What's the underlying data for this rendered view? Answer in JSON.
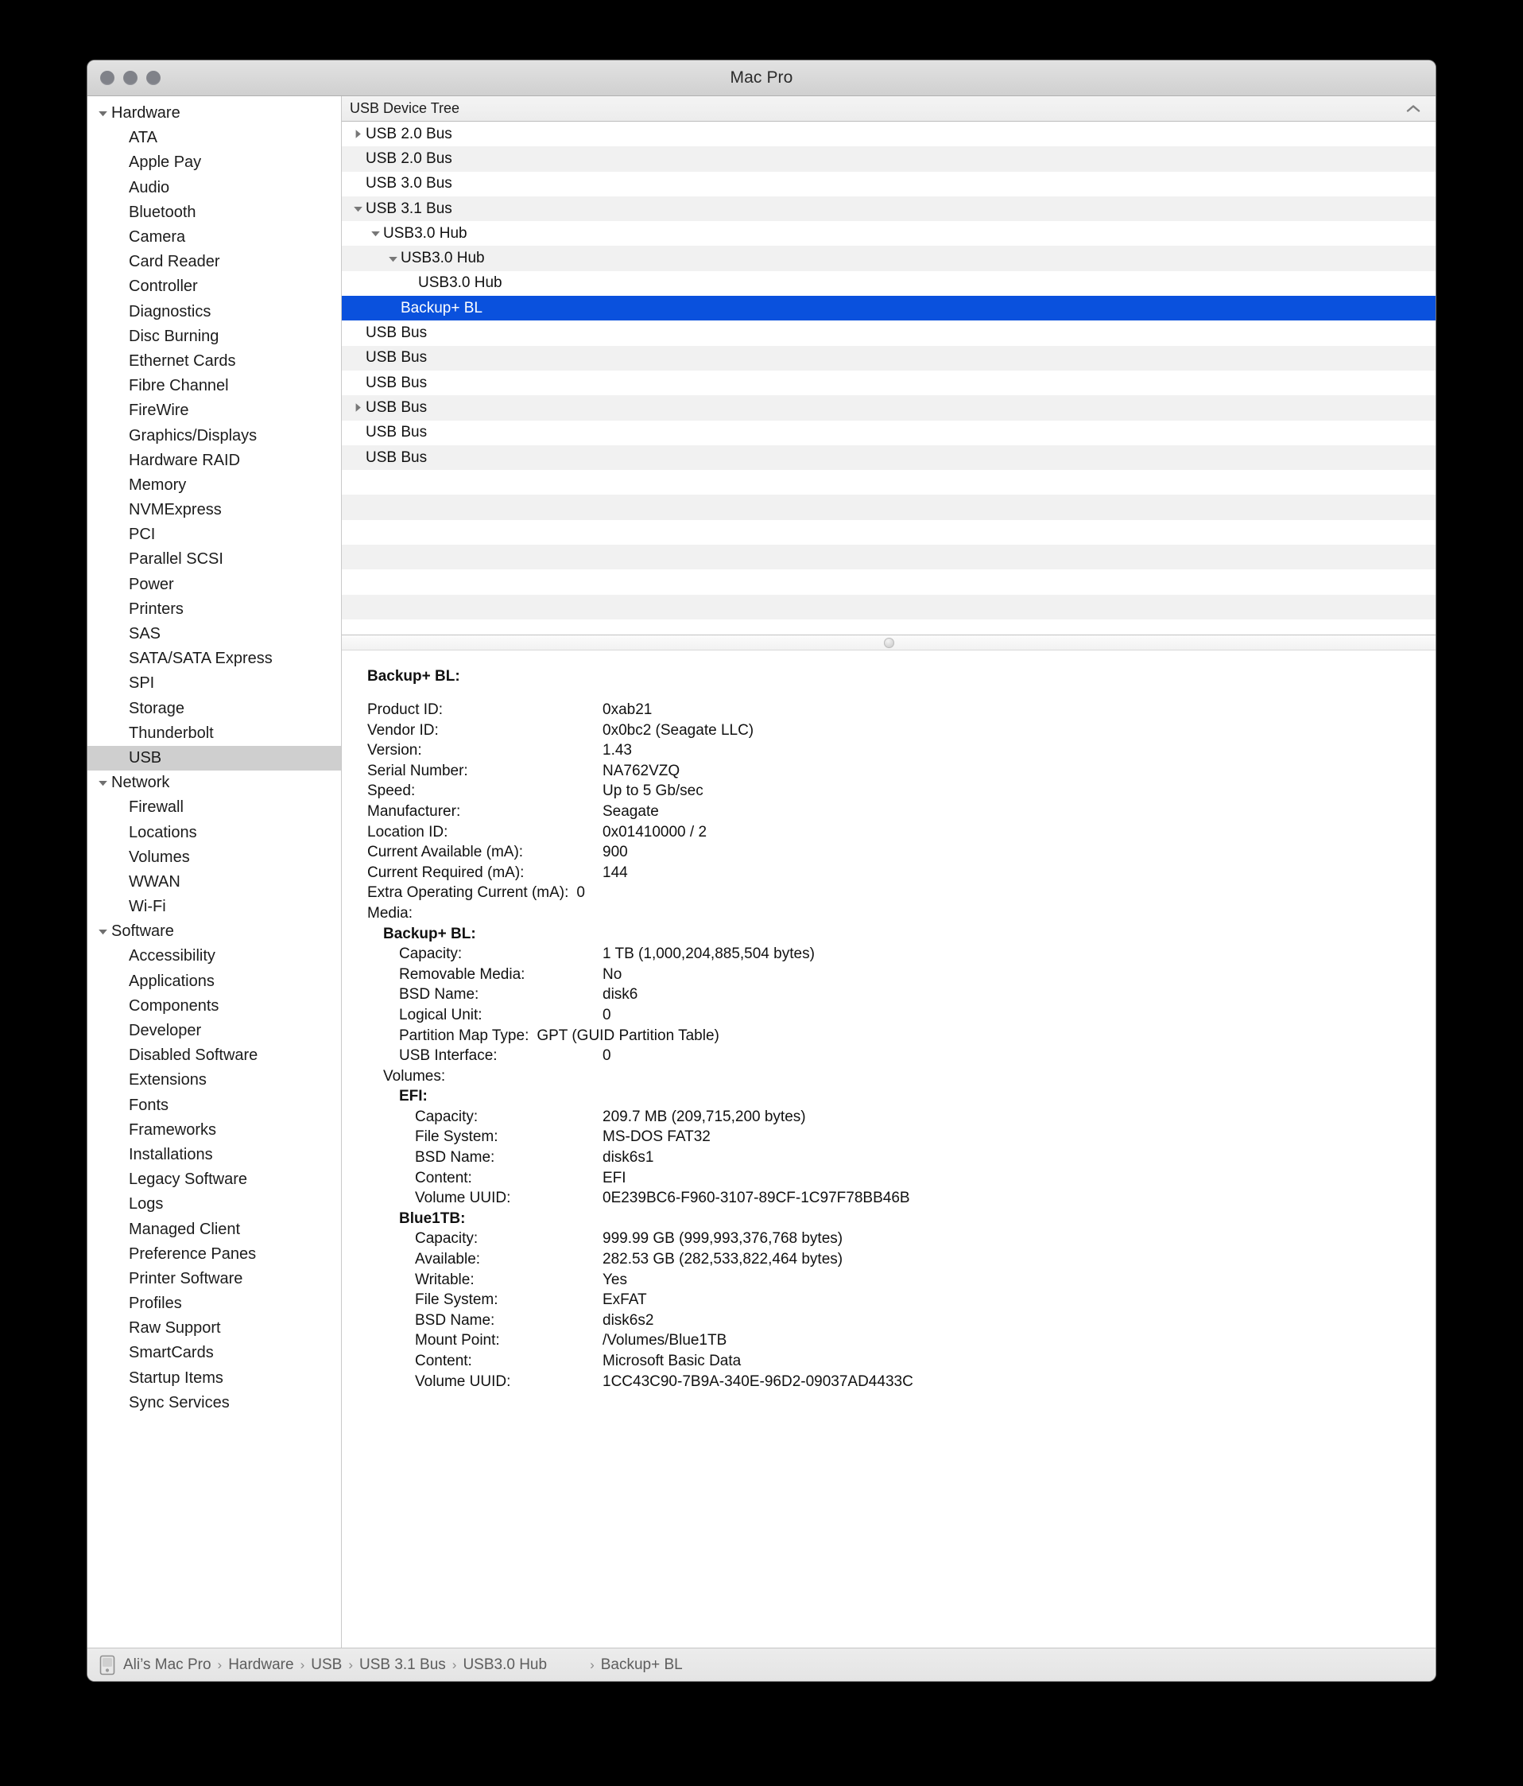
{
  "window": {
    "title": "Mac Pro",
    "traffic_lights": [
      "close",
      "minimize",
      "zoom"
    ]
  },
  "sidebar": {
    "groups": [
      {
        "label": "Hardware",
        "expanded": true,
        "items": [
          "ATA",
          "Apple Pay",
          "Audio",
          "Bluetooth",
          "Camera",
          "Card Reader",
          "Controller",
          "Diagnostics",
          "Disc Burning",
          "Ethernet Cards",
          "Fibre Channel",
          "FireWire",
          "Graphics/Displays",
          "Hardware RAID",
          "Memory",
          "NVMExpress",
          "PCI",
          "Parallel SCSI",
          "Power",
          "Printers",
          "SAS",
          "SATA/SATA Express",
          "SPI",
          "Storage",
          "Thunderbolt",
          "USB"
        ]
      },
      {
        "label": "Network",
        "expanded": true,
        "items": [
          "Firewall",
          "Locations",
          "Volumes",
          "WWAN",
          "Wi-Fi"
        ]
      },
      {
        "label": "Software",
        "expanded": true,
        "items": [
          "Accessibility",
          "Applications",
          "Components",
          "Developer",
          "Disabled Software",
          "Extensions",
          "Fonts",
          "Frameworks",
          "Installations",
          "Legacy Software",
          "Logs",
          "Managed Client",
          "Preference Panes",
          "Printer Software",
          "Profiles",
          "Raw Support",
          "SmartCards",
          "Startup Items",
          "Sync Services"
        ]
      }
    ],
    "selected": "USB"
  },
  "tree": {
    "header": "USB Device Tree",
    "sort_indicator": "chevron-up",
    "rows": [
      {
        "label": "USB 2.0 Bus",
        "depth": 0,
        "disclosure": "collapsed",
        "selected": false
      },
      {
        "label": "USB 2.0 Bus",
        "depth": 0,
        "disclosure": "none",
        "selected": false
      },
      {
        "label": "USB 3.0 Bus",
        "depth": 0,
        "disclosure": "none",
        "selected": false
      },
      {
        "label": "USB 3.1 Bus",
        "depth": 0,
        "disclosure": "expanded",
        "selected": false
      },
      {
        "label": "USB3.0 Hub",
        "depth": 1,
        "disclosure": "expanded",
        "selected": false
      },
      {
        "label": "USB3.0 Hub",
        "depth": 2,
        "disclosure": "expanded",
        "selected": false
      },
      {
        "label": "USB3.0 Hub",
        "depth": 3,
        "disclosure": "none",
        "selected": false
      },
      {
        "label": "Backup+  BL",
        "depth": 2,
        "disclosure": "none",
        "selected": true
      },
      {
        "label": "USB Bus",
        "depth": 0,
        "disclosure": "none",
        "selected": false
      },
      {
        "label": "USB Bus",
        "depth": 0,
        "disclosure": "none",
        "selected": false
      },
      {
        "label": "USB Bus",
        "depth": 0,
        "disclosure": "none",
        "selected": false
      },
      {
        "label": "USB Bus",
        "depth": 0,
        "disclosure": "collapsed",
        "selected": false
      },
      {
        "label": "USB Bus",
        "depth": 0,
        "disclosure": "none",
        "selected": false
      },
      {
        "label": "USB Bus",
        "depth": 0,
        "disclosure": "none",
        "selected": false
      }
    ]
  },
  "detail": {
    "title": "Backup+  BL:",
    "device_properties": [
      {
        "key": "Product ID:",
        "value": "0xab21"
      },
      {
        "key": "Vendor ID:",
        "value": "0x0bc2  (Seagate LLC)"
      },
      {
        "key": "Version:",
        "value": "1.43"
      },
      {
        "key": "Serial Number:",
        "value": "NA762VZQ"
      },
      {
        "key": "Speed:",
        "value": "Up to 5 Gb/sec"
      },
      {
        "key": "Manufacturer:",
        "value": "Seagate"
      },
      {
        "key": "Location ID:",
        "value": "0x01410000 / 2"
      },
      {
        "key": "Current Available (mA):",
        "value": "900"
      },
      {
        "key": "Current Required (mA):",
        "value": "144"
      },
      {
        "key": "Extra Operating Current (mA):",
        "value": "0"
      }
    ],
    "media_label": "Media:",
    "media": {
      "name": "Backup+  BL:",
      "properties": [
        {
          "key": "Capacity:",
          "value": "1 TB (1,000,204,885,504 bytes)"
        },
        {
          "key": "Removable Media:",
          "value": "No"
        },
        {
          "key": "BSD Name:",
          "value": "disk6"
        },
        {
          "key": "Logical Unit:",
          "value": "0"
        },
        {
          "key": "Partition Map Type:",
          "value": "GPT (GUID Partition Table)"
        },
        {
          "key": "USB Interface:",
          "value": "0"
        }
      ],
      "volumes_label": "Volumes:",
      "volumes": [
        {
          "name": "EFI:",
          "properties": [
            {
              "key": "Capacity:",
              "value": "209.7 MB (209,715,200 bytes)"
            },
            {
              "key": "File System:",
              "value": "MS-DOS FAT32"
            },
            {
              "key": "BSD Name:",
              "value": "disk6s1"
            },
            {
              "key": "Content:",
              "value": "EFI"
            },
            {
              "key": "Volume UUID:",
              "value": "0E239BC6-F960-3107-89CF-1C97F78BB46B"
            }
          ]
        },
        {
          "name": "Blue1TB:",
          "properties": [
            {
              "key": "Capacity:",
              "value": "999.99 GB (999,993,376,768 bytes)"
            },
            {
              "key": "Available:",
              "value": "282.53 GB (282,533,822,464 bytes)"
            },
            {
              "key": "Writable:",
              "value": "Yes"
            },
            {
              "key": "File System:",
              "value": "ExFAT"
            },
            {
              "key": "BSD Name:",
              "value": "disk6s2"
            },
            {
              "key": "Mount Point:",
              "value": "/Volumes/Blue1TB"
            },
            {
              "key": "Content:",
              "value": "Microsoft Basic Data"
            },
            {
              "key": "Volume UUID:",
              "value": "1CC43C90-7B9A-340E-96D2-09037AD4433C"
            }
          ]
        }
      ]
    }
  },
  "statusbar": {
    "icon": "mac-pro-icon",
    "separator": "›",
    "crumbs": [
      "Ali’s Mac Pro",
      "Hardware",
      "USB",
      "USB 3.1 Bus",
      "USB3.0 Hub"
    ],
    "trailing_crumb": "Backup+  BL"
  },
  "colors": {
    "selection_blue": "#0a51dd",
    "sidebar_selection": "#cfcfcf",
    "row_stripe": "#f1f1f1"
  }
}
